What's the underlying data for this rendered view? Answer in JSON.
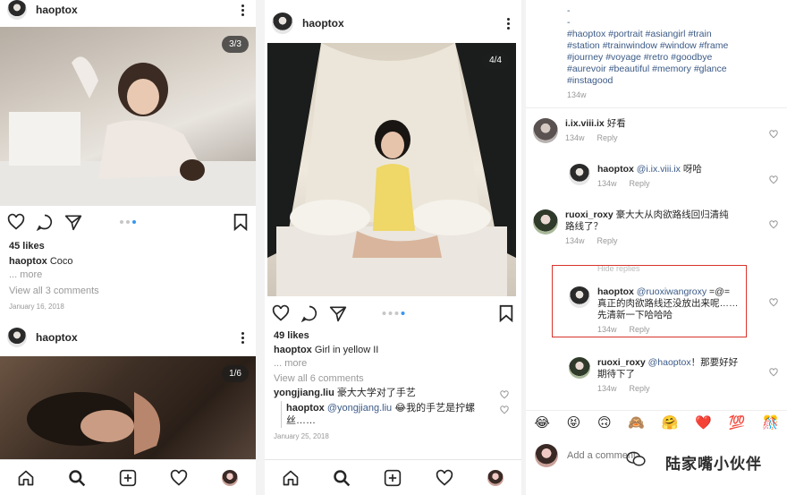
{
  "panel1": {
    "post1": {
      "username": "haoptox",
      "counter": "3/3",
      "likes": "45 likes",
      "caption_user": "haoptox",
      "caption_text": "Coco",
      "more": "... more",
      "view_comments": "View all 3 comments",
      "date": "January 16, 2018"
    },
    "post2": {
      "username": "haoptox",
      "counter": "1/6"
    }
  },
  "panel2": {
    "username": "haoptox",
    "counter": "4/4",
    "likes": "49 likes",
    "caption_user": "haoptox",
    "caption_text": "Girl in yellow II",
    "more": "... more",
    "view_comments": "View all 6 comments",
    "comment1_user": "yongjiang.liu",
    "comment1_text": "豪大大学对了手艺",
    "reply_user": "haoptox",
    "reply_mention": "@yongjiang.liu",
    "reply_text": "😂我的手艺是拧螺",
    "reply_text2": "丝……",
    "date": "January 25, 2018"
  },
  "panel3": {
    "hashtags": "-\n-\n#haoptox #portrait #asiangirl #train\n#station #trainwindow #window #frame\n#journey #voyage #retro #goodbye\n#aurevoir #beautiful #memory #glance\n#instagood",
    "hashtags_time": "134w",
    "comments": [
      {
        "user": "i.ix.viii.ix",
        "text": "好看",
        "time": "134w",
        "reply": "Reply"
      },
      {
        "user": "haoptox",
        "mention": "@i.ix.viii.ix",
        "text": "呀哈",
        "time": "134w",
        "reply": "Reply"
      },
      {
        "user": "ruoxi_roxy",
        "text": "豪大大从肉欲路线回归清纯",
        "text2": "路线了？",
        "time": "134w",
        "reply": "Reply"
      },
      {
        "user": "haoptox",
        "mention": "@ruoxiwangroxy",
        "text": "=@=",
        "text2": "真正的肉欲路线还没放出来呢……",
        "text3": "先清新一下哈哈哈",
        "time": "134w",
        "reply": "Reply"
      },
      {
        "user": "ruoxi_roxy",
        "mention": "@haoptox",
        "text": "！那要好好",
        "text2": "期待下了",
        "time": "134w",
        "reply": "Reply"
      }
    ],
    "hide_replies": "Hide replies",
    "emojis": [
      "😂",
      "😝",
      "🙃",
      "🙈",
      "🤗",
      "❤️",
      "💯",
      "🎊"
    ],
    "add_comment_placeholder": "Add a comment...",
    "watermark": "陆家嘴小伙伴"
  }
}
